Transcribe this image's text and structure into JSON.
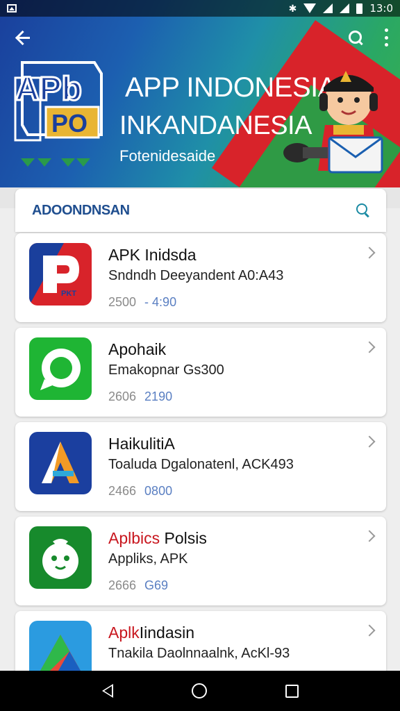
{
  "status_bar": {
    "time": "13:0"
  },
  "hero": {
    "logo_text_top": "APb",
    "logo_text_bottom": "PO",
    "title": "APP INDONESIA",
    "subtitle": "INKANDANESIA",
    "tagline": "Fotenidesaide"
  },
  "section": {
    "title": "ADOONDNSAN"
  },
  "apps": [
    {
      "name": "APK Inidsda",
      "name_red": "",
      "description": "Sndndh Deeyandent  A0:A43",
      "meta_1": "2500",
      "meta_2": "- 4:90",
      "icon": "p-logo-icon",
      "icon_text": "PKT"
    },
    {
      "name": "Apohaik",
      "name_red": "",
      "description": "Emakopnar Gs300",
      "meta_1": "2606",
      "meta_2": "2190",
      "icon": "chat-bubble-icon",
      "icon_text": ""
    },
    {
      "name": "HaikulitiA",
      "name_red": "",
      "description": "Toaluda Dgalonatenl, ACK493",
      "meta_1": "2466",
      "meta_2": "0800",
      "icon": "a-triangle-icon",
      "icon_text": ""
    },
    {
      "name": " Polsis",
      "name_red": "Aplbics",
      "description": "Appliks, APK",
      "meta_1": "2666",
      "meta_2": "G69",
      "icon": "robot-face-icon",
      "icon_text": ""
    },
    {
      "name": "Iindasin",
      "name_red": "Aplk",
      "description": "Tnakila Daolnnaalnk, AcKl-93",
      "meta_1": "",
      "meta_2": "",
      "icon": "prism-icon",
      "icon_text": ""
    }
  ],
  "colors": {
    "accent": "#1f4e8f",
    "red": "#c8161e",
    "green": "#2aa864"
  }
}
